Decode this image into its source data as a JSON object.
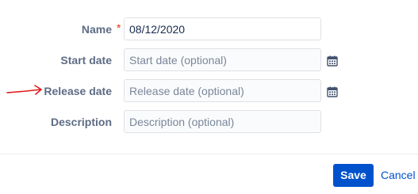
{
  "form": {
    "name": {
      "label": "Name",
      "required_mark": "*",
      "value": "08/12/2020"
    },
    "start_date": {
      "label": "Start date",
      "placeholder": "Start date (optional)",
      "icon": "calendar-icon"
    },
    "release_date": {
      "label": "Release date",
      "placeholder": "Release date (optional)",
      "icon": "calendar-icon"
    },
    "description": {
      "label": "Description",
      "placeholder": "Description (optional)"
    }
  },
  "annotation": {
    "icon": "red-arrow",
    "color": "#e01b1b"
  },
  "actions": {
    "save_label": "Save",
    "cancel_label": "Cancel"
  },
  "colors": {
    "primary": "#0052cc",
    "label": "#5e6c84",
    "required": "#de350b"
  }
}
